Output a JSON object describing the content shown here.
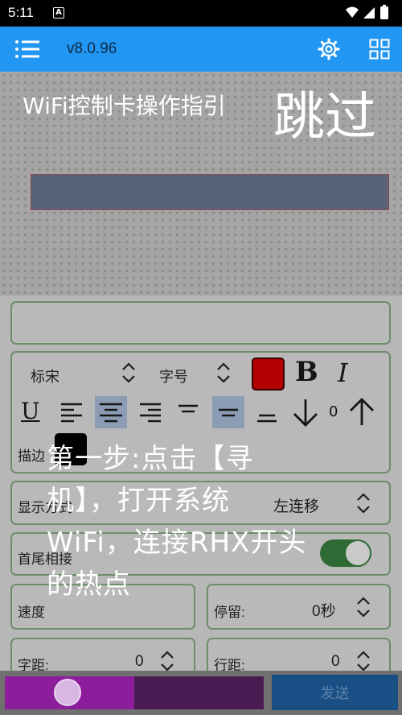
{
  "status_bar": {
    "time": "5:11",
    "notification_glyph": "A"
  },
  "app_bar": {
    "version": "v8.0.96"
  },
  "font_row": {
    "font_family": "标宋",
    "font_size_label": "字号",
    "text_color": "#b30000",
    "bold": "B",
    "italic": "I",
    "underline": "U"
  },
  "spacing": {
    "value": "0"
  },
  "stroke": {
    "label": "描边"
  },
  "display_mode": {
    "label": "显示方式",
    "value": "左连移"
  },
  "head_tail": {
    "label": "首尾相接",
    "enabled": true
  },
  "speed": {
    "label": "速度",
    "stay_label": "停留:",
    "stay_value": "0秒"
  },
  "char_spacing": {
    "label": "字距:",
    "value": "0"
  },
  "line_spacing": {
    "label": "行距:",
    "value": "0"
  },
  "send": {
    "label": "发送"
  },
  "guide": {
    "title": "WiFi控制卡操作指引",
    "skip": "跳过",
    "step": "第一步:点击【寻机】，打开系统WiFi，连接RHX开头的热点"
  },
  "colors": {
    "accent": "#2196f3",
    "slider": "#8c1e9c"
  },
  "slider": {
    "level": 0.5
  }
}
